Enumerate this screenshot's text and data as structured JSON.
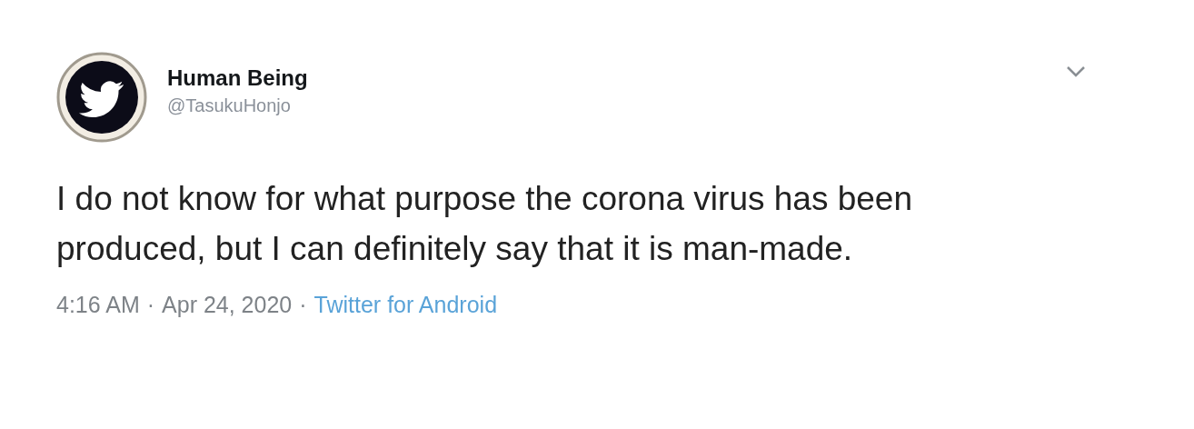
{
  "tweet": {
    "author": {
      "name": "Human Being",
      "handle": "@TasukuHonjo"
    },
    "text": "I do not know for what purpose the corona virus has been produced, but I can definitely say that it is man-made.",
    "time": "4:16 AM",
    "separator_1": "·",
    "date": "Apr 24, 2020",
    "separator_2": "·",
    "source": "Twitter for Android"
  }
}
